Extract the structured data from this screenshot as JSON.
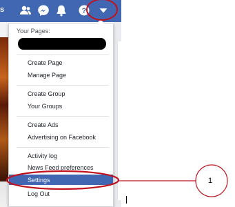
{
  "topbar": {
    "cut_text": "s",
    "icons": [
      "friends-icon",
      "messenger-icon",
      "notifications-bell-icon",
      "help-icon",
      "account-dropdown-icon"
    ],
    "colors": {
      "bar": "#4267b2",
      "icon": "#ffffff"
    }
  },
  "menu": {
    "pages_header": "Your Pages:",
    "redacted_page_name": "",
    "groups": [
      {
        "items": [
          "Create Page",
          "Manage Page"
        ]
      },
      {
        "items": [
          "Create Group",
          "Your Groups"
        ]
      },
      {
        "items": [
          "Create Ads",
          "Advertising on Facebook"
        ]
      },
      {
        "items": [
          "Activity log",
          "News Feed preferences",
          "Settings",
          "Log Out"
        ]
      }
    ],
    "highlighted_item": "Settings",
    "highlight_color": "#4267b2"
  },
  "annotation": {
    "callout_number": "1",
    "marker_color": "#c0121c"
  }
}
